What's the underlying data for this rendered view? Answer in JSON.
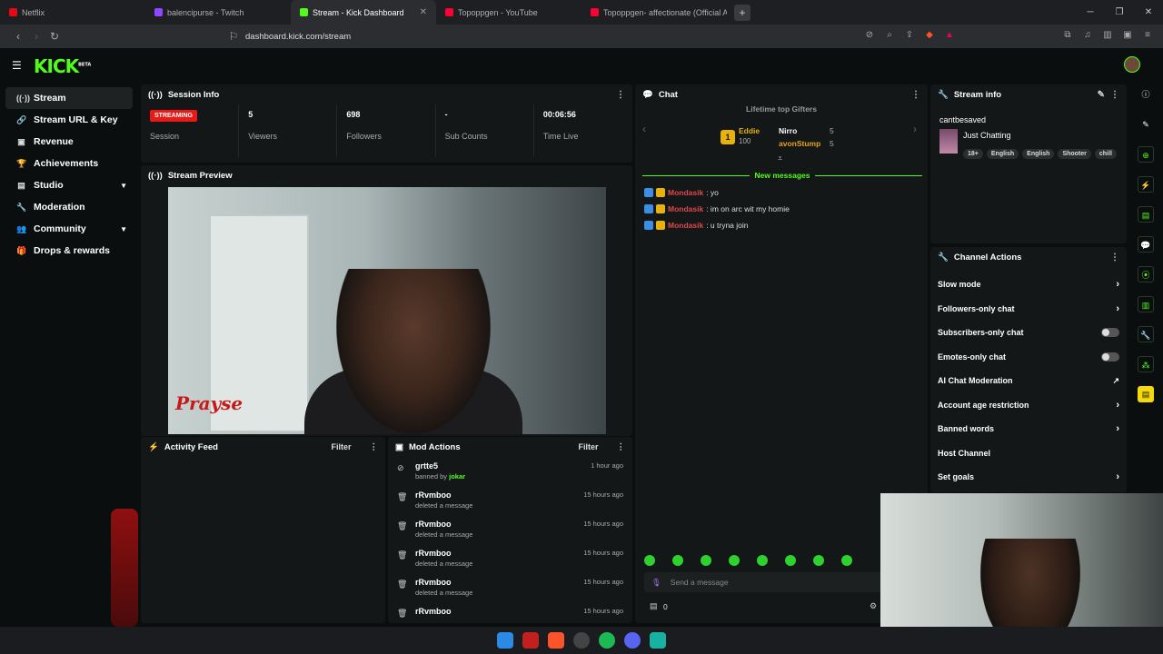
{
  "browser": {
    "tabs": [
      {
        "label": "Netflix",
        "color": "#e50914"
      },
      {
        "label": "balencipurse - Twitch",
        "color": "#9146ff"
      },
      {
        "label": "Stream - Kick Dashboard",
        "color": "#53fc18",
        "active": true
      },
      {
        "label": "Topoppgen - YouTube",
        "color": "#ff0033"
      },
      {
        "label": "Topoppgen- affectionate (Official Au",
        "color": "#ff0033"
      }
    ],
    "url": "dashboard.kick.com/stream"
  },
  "app": {
    "logo": "KICK",
    "logo_badge": "BETA",
    "accent": "#53fc18"
  },
  "sidebar": {
    "items": [
      {
        "label": "Stream",
        "icon": "broadcast-icon"
      },
      {
        "label": "Stream URL & Key",
        "icon": "link-icon"
      },
      {
        "label": "Revenue",
        "icon": "revenue-icon"
      },
      {
        "label": "Achievements",
        "icon": "trophy-icon"
      },
      {
        "label": "Studio",
        "icon": "studio-icon"
      },
      {
        "label": "Moderation",
        "icon": "wrench-icon"
      },
      {
        "label": "Community",
        "icon": "community-icon"
      },
      {
        "label": "Drops & rewards",
        "icon": "gift-icon"
      }
    ]
  },
  "session": {
    "title": "Session Info",
    "status": "STREAMING",
    "session_label": "Session",
    "viewers": "5",
    "viewers_label": "Viewers",
    "followers": "698",
    "followers_label": "Followers",
    "subs": "-",
    "subs_label": "Sub Counts",
    "time": "00:06:56",
    "time_label": "Time Live"
  },
  "preview": {
    "title": "Stream Preview",
    "watermark": "Prayse"
  },
  "activity": {
    "title": "Activity Feed",
    "filter": "Filter"
  },
  "mod": {
    "title": "Mod Actions",
    "filter": "Filter",
    "items": [
      {
        "user": "grtte5",
        "action": "banned by",
        "by": "jokar",
        "time": "1 hour ago"
      },
      {
        "user": "rRvmboo",
        "action": "deleted a message",
        "time": "15 hours ago"
      },
      {
        "user": "rRvmboo",
        "action": "deleted a message",
        "time": "15 hours ago"
      },
      {
        "user": "rRvmboo",
        "action": "deleted a message",
        "time": "15 hours ago"
      },
      {
        "user": "rRvmboo",
        "action": "deleted a message",
        "time": "15 hours ago"
      },
      {
        "user": "rRvmboo",
        "action": "",
        "time": "15 hours ago"
      }
    ]
  },
  "chat": {
    "title": "Chat",
    "gifters_title": "Lifetime top Gifters",
    "gifters": [
      {
        "rank": "1",
        "name": "Eddie",
        "count": "100"
      },
      {
        "name": "Nirro",
        "count": "5"
      },
      {
        "name": "avonStump",
        "count": "5"
      }
    ],
    "new_messages": "New messages",
    "messages": [
      {
        "user": "Mondasik",
        "text": ": yo"
      },
      {
        "user": "Mondasik",
        "text": ": im on arc wit my homie"
      },
      {
        "user": "Mondasik",
        "text": ": u tryna join"
      }
    ],
    "placeholder": "Send a message",
    "count": "0"
  },
  "stream_info": {
    "title": "Stream info",
    "username": "cantbesaved",
    "category": "Just Chatting",
    "tags": [
      "18+",
      "English",
      "English",
      "Shooter",
      "chill"
    ]
  },
  "channel_actions": {
    "title": "Channel Actions",
    "items": [
      {
        "label": "Slow mode",
        "control": "chevron"
      },
      {
        "label": "Followers-only chat",
        "control": "chevron"
      },
      {
        "label": "Subscribers-only chat",
        "control": "toggle"
      },
      {
        "label": "Emotes-only chat",
        "control": "toggle"
      },
      {
        "label": "AI Chat Moderation",
        "control": "external"
      },
      {
        "label": "Account age restriction",
        "control": "chevron"
      },
      {
        "label": "Banned words",
        "control": "chevron"
      },
      {
        "label": "Host Channel",
        "control": "none"
      },
      {
        "label": "Set goals",
        "control": "chevron"
      }
    ]
  }
}
